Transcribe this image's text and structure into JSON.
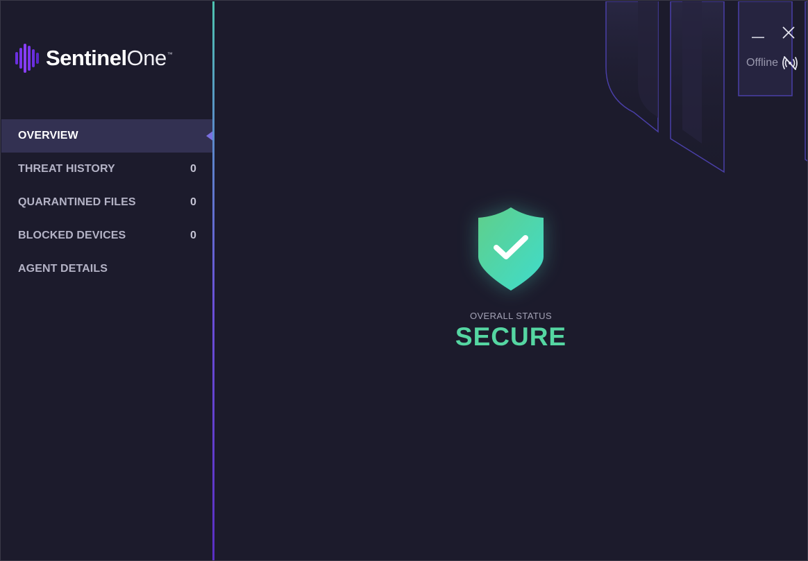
{
  "app": {
    "brand_strong": "Sentinel",
    "brand_light": "One",
    "brand_tm": "™"
  },
  "sidebar": {
    "items": [
      {
        "label": "OVERVIEW",
        "count": "",
        "active": true
      },
      {
        "label": "THREAT HISTORY",
        "count": "0",
        "active": false
      },
      {
        "label": "QUARANTINED FILES",
        "count": "0",
        "active": false
      },
      {
        "label": "BLOCKED DEVICES",
        "count": "0",
        "active": false
      },
      {
        "label": "AGENT DETAILS",
        "count": "",
        "active": false
      }
    ]
  },
  "header": {
    "connection_status": "Offline",
    "connection_icon": "no-signal-icon",
    "minimize_icon": "minimize-icon",
    "close_icon": "close-icon"
  },
  "overview": {
    "status_caption": "OVERALL STATUS",
    "status_value": "SECURE",
    "status_icon": "shield-check-icon"
  },
  "colors": {
    "background": "#1c1b2c",
    "active_item": "#333152",
    "accent": "#7a6fe0",
    "secure": "#55d6a2"
  }
}
